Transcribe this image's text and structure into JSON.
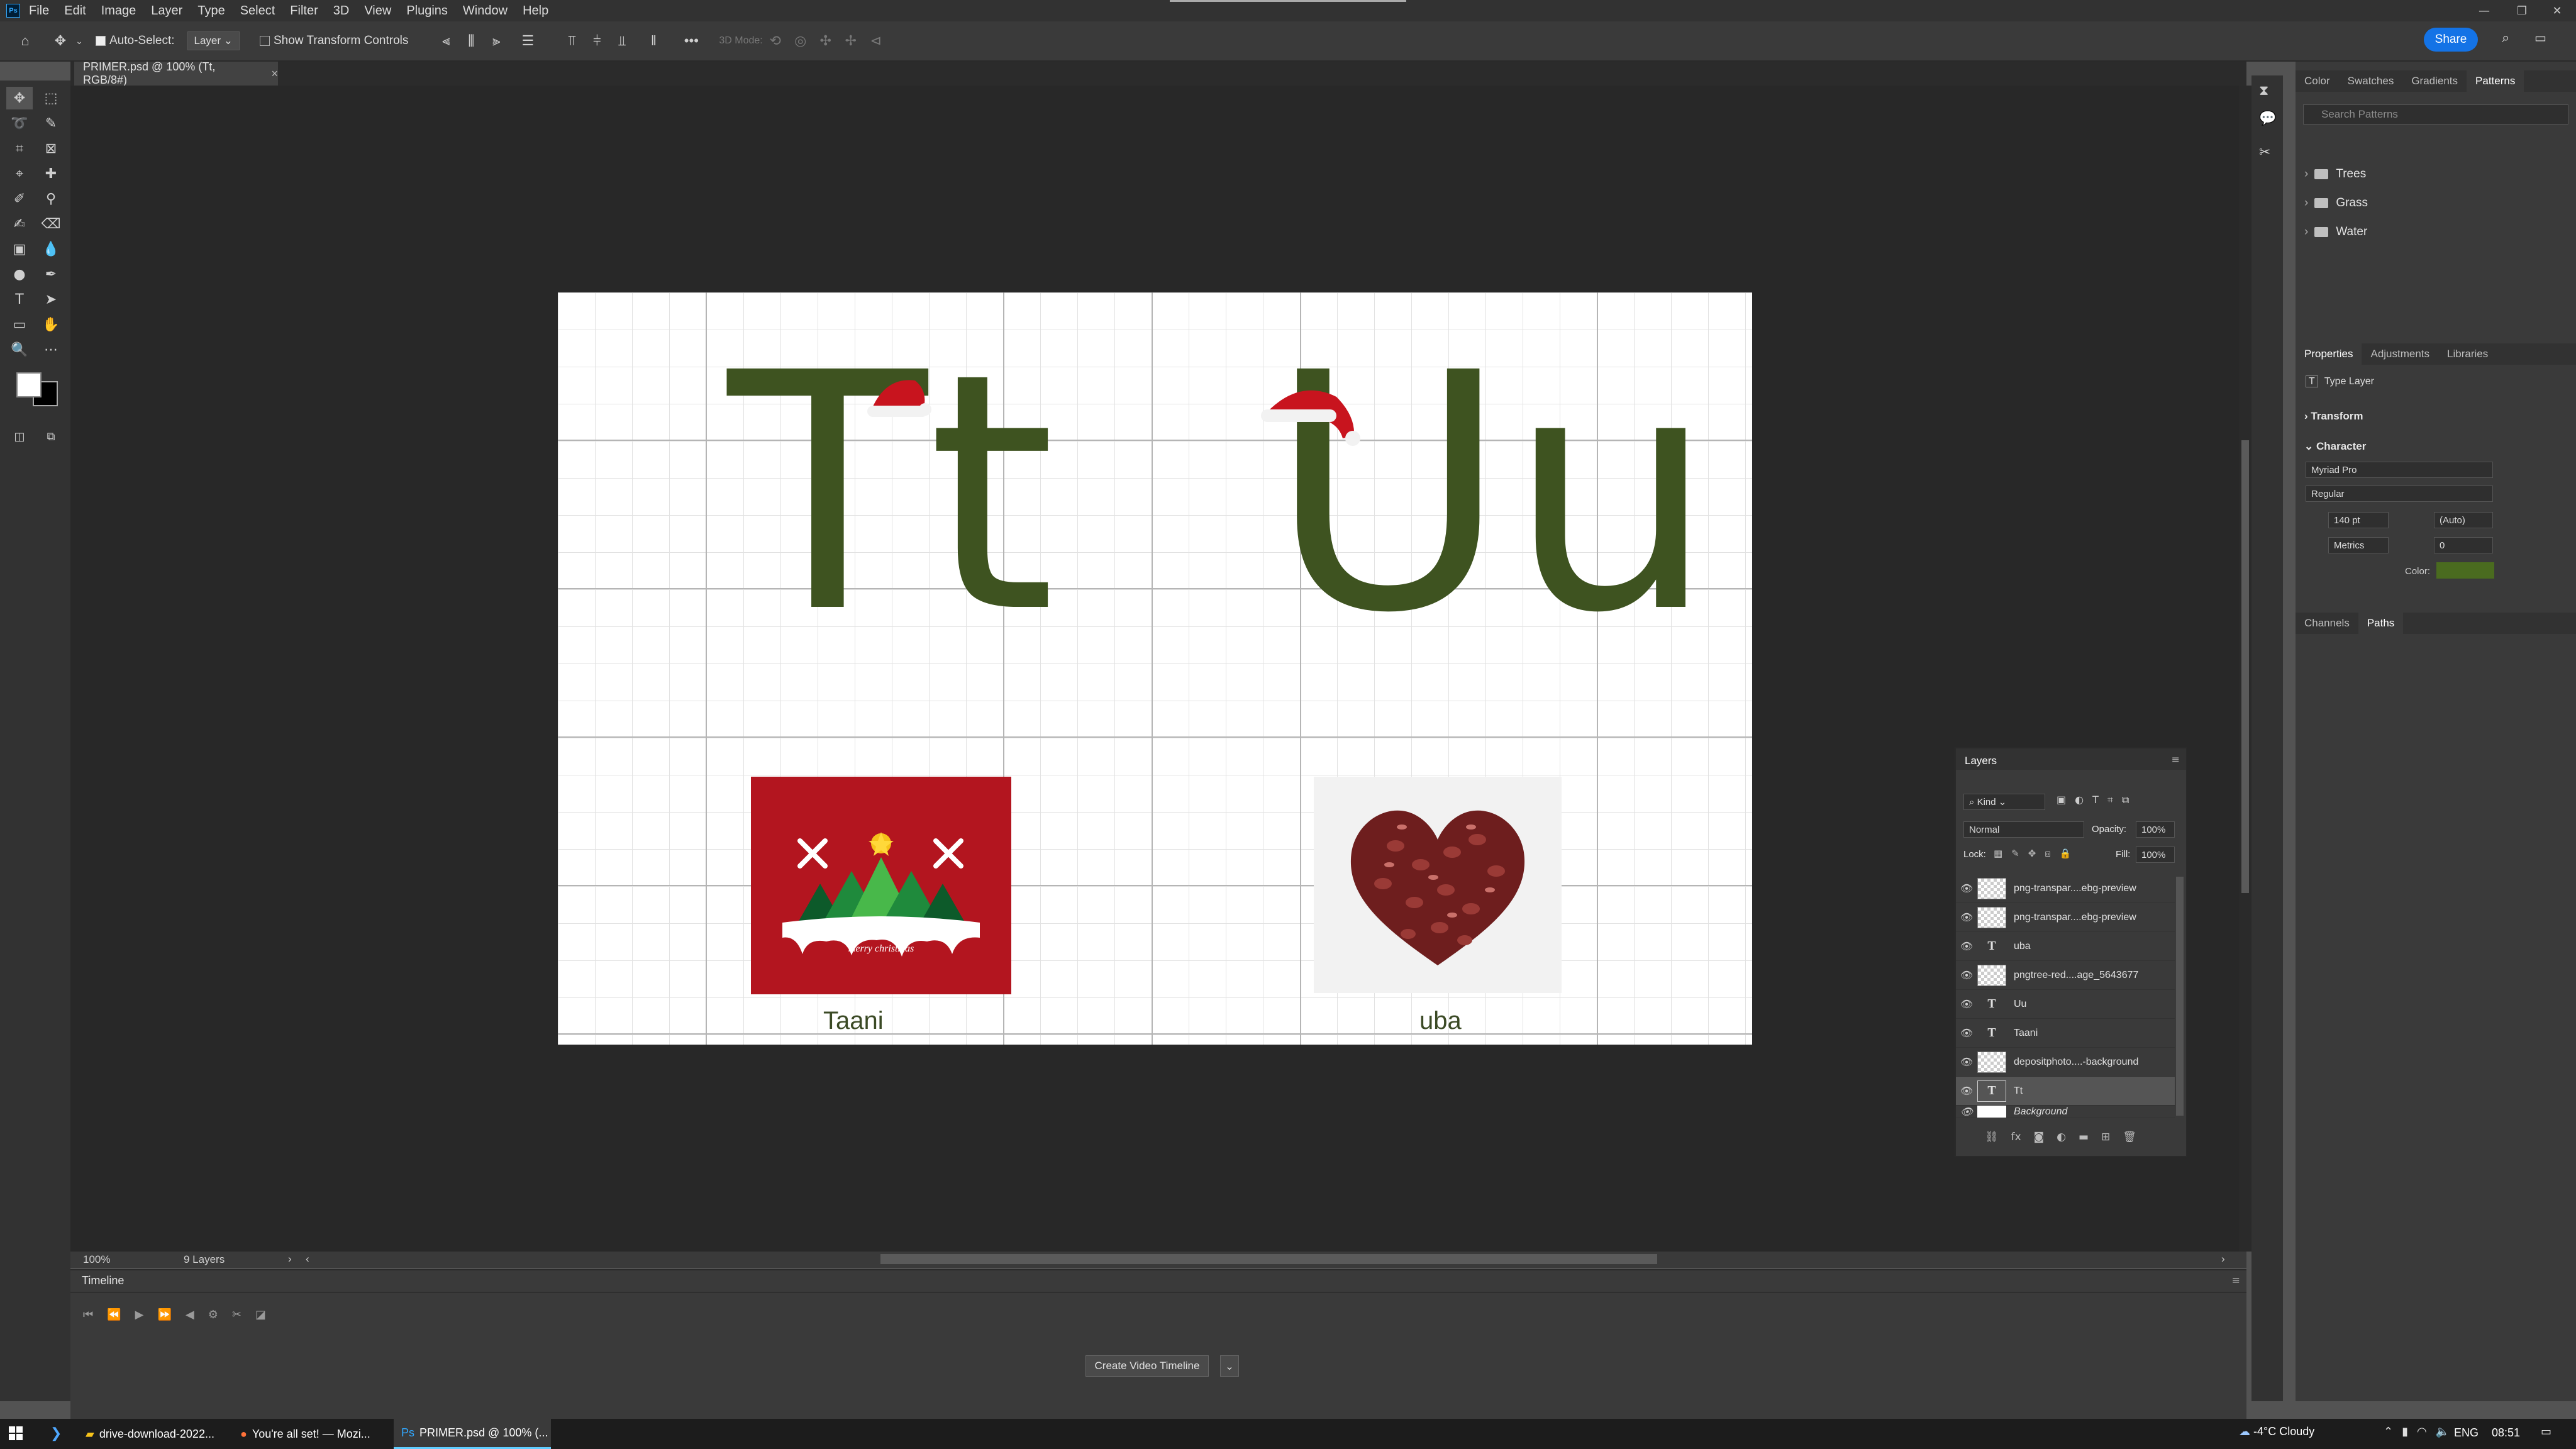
{
  "app": {
    "logo_label": "Ps",
    "menu": [
      "File",
      "Edit",
      "Image",
      "Layer",
      "Type",
      "Select",
      "Filter",
      "3D",
      "View",
      "Plugins",
      "Window",
      "Help"
    ]
  },
  "options_bar": {
    "auto_select_label": "Auto-Select:",
    "auto_select_value": "Layer",
    "show_transform_label": "Show Transform Controls",
    "mode_3d_label": "3D Mode:",
    "share_label": "Share"
  },
  "document": {
    "tab_title": "PRIMER.psd @ 100% (Tt, RGB/8#)",
    "letters_left": "Tt",
    "letters_right": "Uu",
    "caption_left": "Taani",
    "caption_right": "uba",
    "card_text": "merry christmas"
  },
  "status": {
    "zoom": "100%",
    "layers_count": "9 Layers"
  },
  "timeline": {
    "title": "Timeline",
    "create_button": "Create Video Timeline"
  },
  "patterns_panel": {
    "tabs": [
      "Color",
      "Swatches",
      "Gradients",
      "Patterns"
    ],
    "active_tab": "Patterns",
    "search_placeholder": "Search Patterns",
    "folders": [
      "Trees",
      "Grass",
      "Water"
    ]
  },
  "properties_panel": {
    "tabs": [
      "Properties",
      "Adjustments",
      "Libraries"
    ],
    "layer_type": "Type Layer",
    "transform_label": "Transform",
    "character_label": "Character",
    "font_family": "Myriad Pro",
    "font_style": "Regular",
    "font_size": "140 pt",
    "leading": "(Auto)",
    "kerning": "Metrics",
    "tracking": "0",
    "color_label": "Color:",
    "color_value": "#4a6b1f"
  },
  "channels_panel": {
    "tabs": [
      "Channels",
      "Paths"
    ]
  },
  "layers_panel": {
    "title": "Layers",
    "kind_label": "Kind",
    "blend_mode": "Normal",
    "opacity_label": "Opacity:",
    "opacity_value": "100%",
    "lock_label": "Lock:",
    "fill_label": "Fill:",
    "fill_value": "100%",
    "layers": [
      {
        "name": "png-transpar....ebg-preview",
        "type": "image"
      },
      {
        "name": "png-transpar....ebg-preview",
        "type": "image"
      },
      {
        "name": "uba",
        "type": "text"
      },
      {
        "name": "pngtree-red....age_5643677",
        "type": "image"
      },
      {
        "name": "Uu",
        "type": "text"
      },
      {
        "name": "Taani",
        "type": "text"
      },
      {
        "name": "depositphoto....-background",
        "type": "image"
      },
      {
        "name": "Tt",
        "type": "text"
      },
      {
        "name": "Background",
        "type": "image"
      }
    ]
  },
  "taskbar": {
    "items": [
      "drive-download-2022...",
      "You're all set! — Mozi...",
      "PRIMER.psd @ 100% (..."
    ],
    "weather": "-4°C  Cloudy",
    "language": "ENG",
    "time": "08:51"
  }
}
